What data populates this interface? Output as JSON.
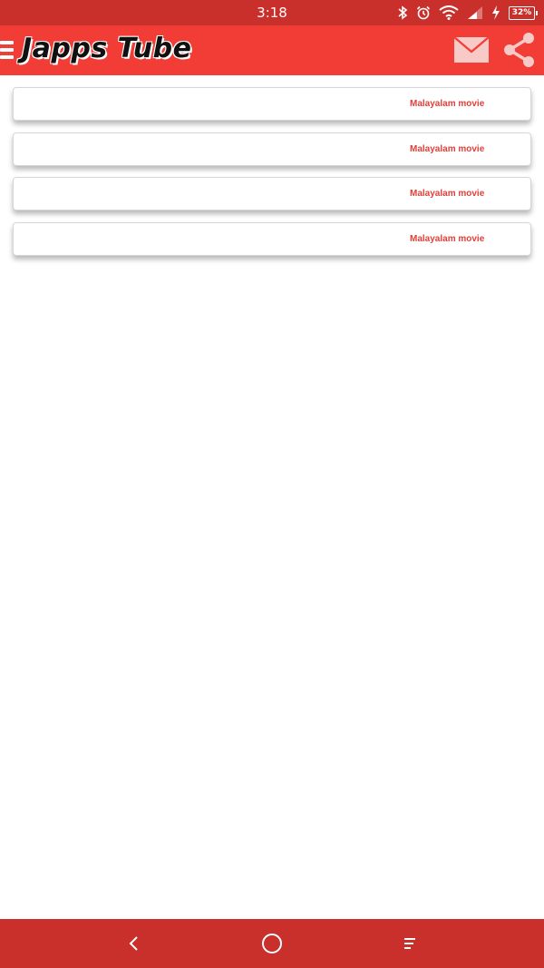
{
  "status_bar": {
    "time": "3:18",
    "battery": "32%",
    "icons": [
      "bluetooth-icon",
      "alarm-icon",
      "wifi-icon",
      "signal-icon",
      "charging-icon",
      "battery-icon"
    ]
  },
  "app_bar": {
    "title": "Japps Tube",
    "icons": [
      "menu-icon",
      "mail-icon",
      "share-icon"
    ]
  },
  "videos": [
    {
      "label": "Malayalam movie"
    },
    {
      "label": "Malayalam movie"
    },
    {
      "label": "Malayalam movie"
    },
    {
      "label": "Malayalam movie"
    }
  ],
  "nav_bar": {
    "icons": [
      "back-icon",
      "home-icon",
      "recents-icon"
    ]
  },
  "colors": {
    "status_bar": "#c9302c",
    "app_bar": "#f23c36",
    "label": "#e0403a",
    "nav_bar": "#c9302c"
  }
}
